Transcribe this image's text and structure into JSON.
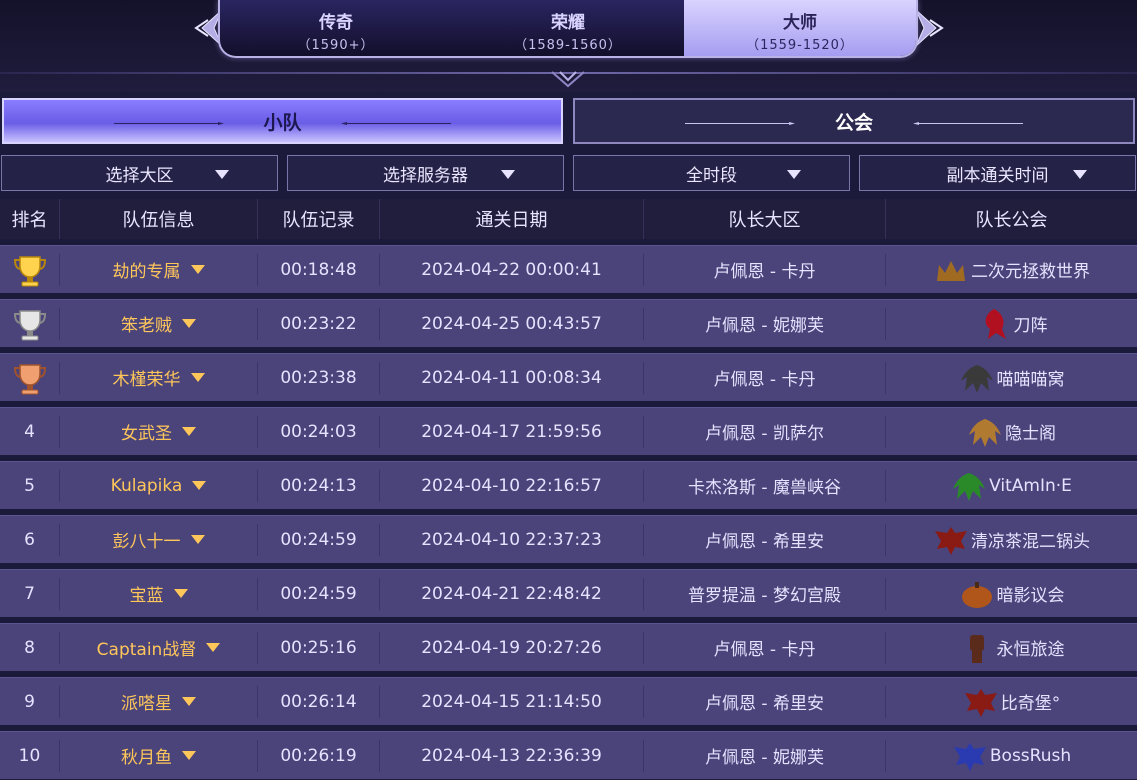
{
  "tiers": [
    {
      "name": "传奇",
      "range": "（1590+）"
    },
    {
      "name": "荣耀",
      "range": "（1589-1560）"
    },
    {
      "name": "大师",
      "range": "（1559-1520）"
    }
  ],
  "active_tier": "大师",
  "tabs": {
    "team": "小队",
    "guild": "公会"
  },
  "filters": [
    "选择大区",
    "选择服务器",
    "全时段",
    "副本通关时间"
  ],
  "columns": [
    "排名",
    "队伍信息",
    "队伍记录",
    "通关日期",
    "队长大区",
    "队长公会"
  ],
  "colors": {
    "accent": "#8a7dff",
    "gold": "#ffc65a",
    "row_bg": "#4a447a",
    "bg": "#1c1a3a"
  },
  "rows": [
    {
      "rank": "trophy-gold-icon",
      "team": "劫的专属",
      "time": "00:18:48",
      "date": "2024-04-22 00:00:41",
      "realm": "卢佩恩 - 卡丹",
      "guild_icon": "crown-emblem-icon",
      "guild": "二次元拯救世界"
    },
    {
      "rank": "trophy-silver-icon",
      "team": "笨老贼",
      "time": "00:23:22",
      "date": "2024-04-25 00:43:57",
      "realm": "卢佩恩 - 妮娜芙",
      "guild_icon": "lion-emblem-icon",
      "guild": "刀阵"
    },
    {
      "rank": "trophy-bronze-icon",
      "team": "木槿荣华",
      "time": "00:23:38",
      "date": "2024-04-11 00:08:34",
      "realm": "卢佩恩 - 卡丹",
      "guild_icon": "demon-emblem-icon",
      "guild": "喵喵喵窝"
    },
    {
      "rank": "4",
      "team": "女武圣",
      "time": "00:24:03",
      "date": "2024-04-17 21:59:56",
      "realm": "卢佩恩 - 凯萨尔",
      "guild_icon": "demon-emblem-icon",
      "guild": "隐士阁"
    },
    {
      "rank": "5",
      "team": "Kulapika",
      "time": "00:24:13",
      "date": "2024-04-10 22:16:57",
      "realm": "卡杰洛斯 - 魔兽峡谷",
      "guild_icon": "demon-emblem-icon",
      "guild": "VitAmIn·E"
    },
    {
      "rank": "6",
      "team": "彭八十一",
      "time": "00:24:59",
      "date": "2024-04-10 22:37:23",
      "realm": "卢佩恩 - 希里安",
      "guild_icon": "eagle-emblem-icon",
      "guild": "清凉茶混二锅头"
    },
    {
      "rank": "7",
      "team": "宝蓝",
      "time": "00:24:59",
      "date": "2024-04-21 22:48:42",
      "realm": "普罗提温 - 梦幻宫殿",
      "guild_icon": "pumpkin-emblem-icon",
      "guild": "暗影议会"
    },
    {
      "rank": "8",
      "team": "Captain战督",
      "time": "00:25:16",
      "date": "2024-04-19 20:27:26",
      "realm": "卢佩恩 - 卡丹",
      "guild_icon": "fist-emblem-icon",
      "guild": "永恒旅途"
    },
    {
      "rank": "9",
      "team": "派嗒星",
      "time": "00:26:14",
      "date": "2024-04-15 21:14:50",
      "realm": "卢佩恩 - 希里安",
      "guild_icon": "eagle-emblem-icon",
      "guild": "比奇堡°"
    },
    {
      "rank": "10",
      "team": "秋月鱼",
      "time": "00:26:19",
      "date": "2024-04-13 22:36:39",
      "realm": "卢佩恩 - 妮娜芙",
      "guild_icon": "eagle-emblem-icon",
      "guild": "BossRush"
    }
  ]
}
